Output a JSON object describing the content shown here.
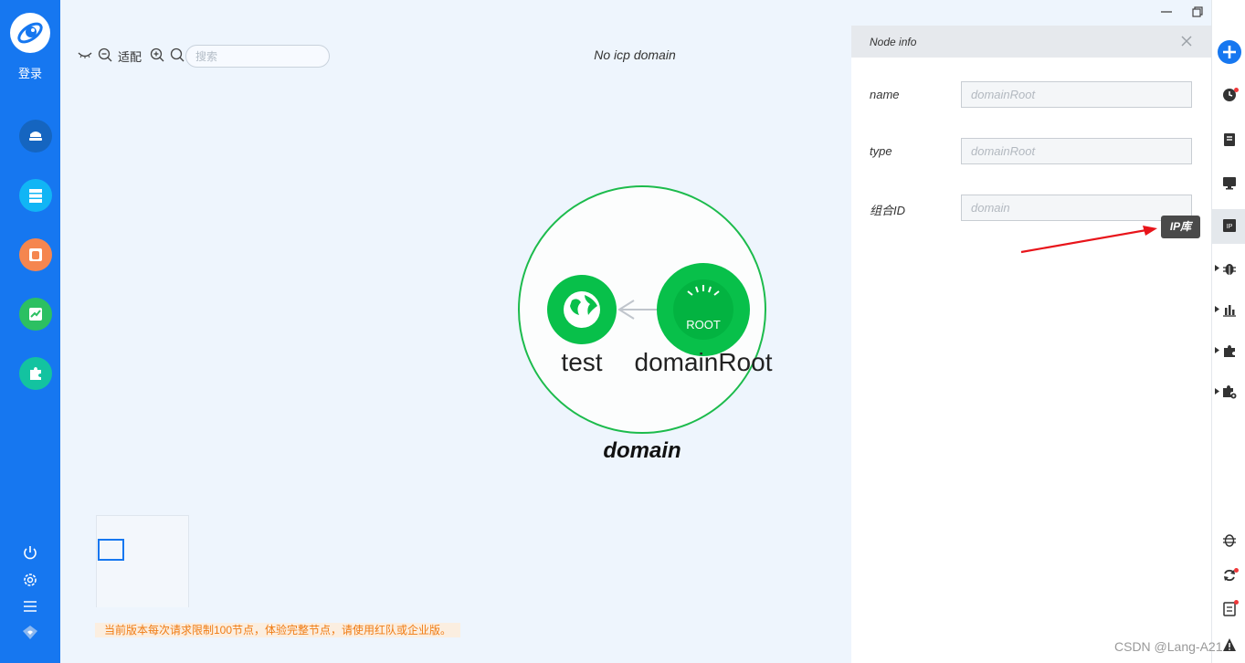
{
  "sidebar": {
    "login_label": "登录",
    "nav": [
      {
        "icon": "user-hat-icon",
        "color": "#1565c0"
      },
      {
        "icon": "server-list-icon",
        "color": "#11b5f5"
      },
      {
        "icon": "bug-report-icon",
        "color": "#f5864f"
      },
      {
        "icon": "trend-chart-icon",
        "color": "#2cc062"
      },
      {
        "icon": "plugin-puzzle-icon",
        "color": "#13c3a0"
      }
    ],
    "bottom_icons": [
      "power-icon",
      "settings-gear-icon",
      "menu-icon",
      "heart-shield-icon"
    ]
  },
  "toolbar": {
    "fit_label": "适配",
    "search_placeholder": "搜索",
    "title": "No icp domain"
  },
  "graph": {
    "group_label": "domain",
    "nodes": [
      {
        "label": "test",
        "icon": "globe-icon"
      },
      {
        "label": "domainRoot",
        "icon": "root-icon",
        "icon_text": "ROOT"
      }
    ],
    "colors": {
      "node": "#08c04a",
      "group_stroke": "#1cbb4c",
      "edge": "#c0c5cc"
    }
  },
  "notice": "当前版本每次请求限制100节点，体验完整节点，请使用红队或企业版。",
  "panel": {
    "title": "Node info",
    "fields": [
      {
        "label": "name",
        "placeholder": "domainRoot"
      },
      {
        "label": "type",
        "placeholder": "domainRoot"
      },
      {
        "label": "组合ID",
        "placeholder": "domain"
      }
    ]
  },
  "rail": {
    "tooltip": "IP库",
    "icons": [
      "add-icon",
      "history-clock-icon",
      "document-icon",
      "monitor-icon",
      "ip-library-icon",
      "bug-icon",
      "bar-chart-icon",
      "puzzle-icon",
      "puzzle-gear-icon",
      "bug-outline-icon",
      "refresh-icon",
      "report-icon",
      "warning-icon"
    ]
  },
  "watermark": "CSDN @Lang-A21"
}
